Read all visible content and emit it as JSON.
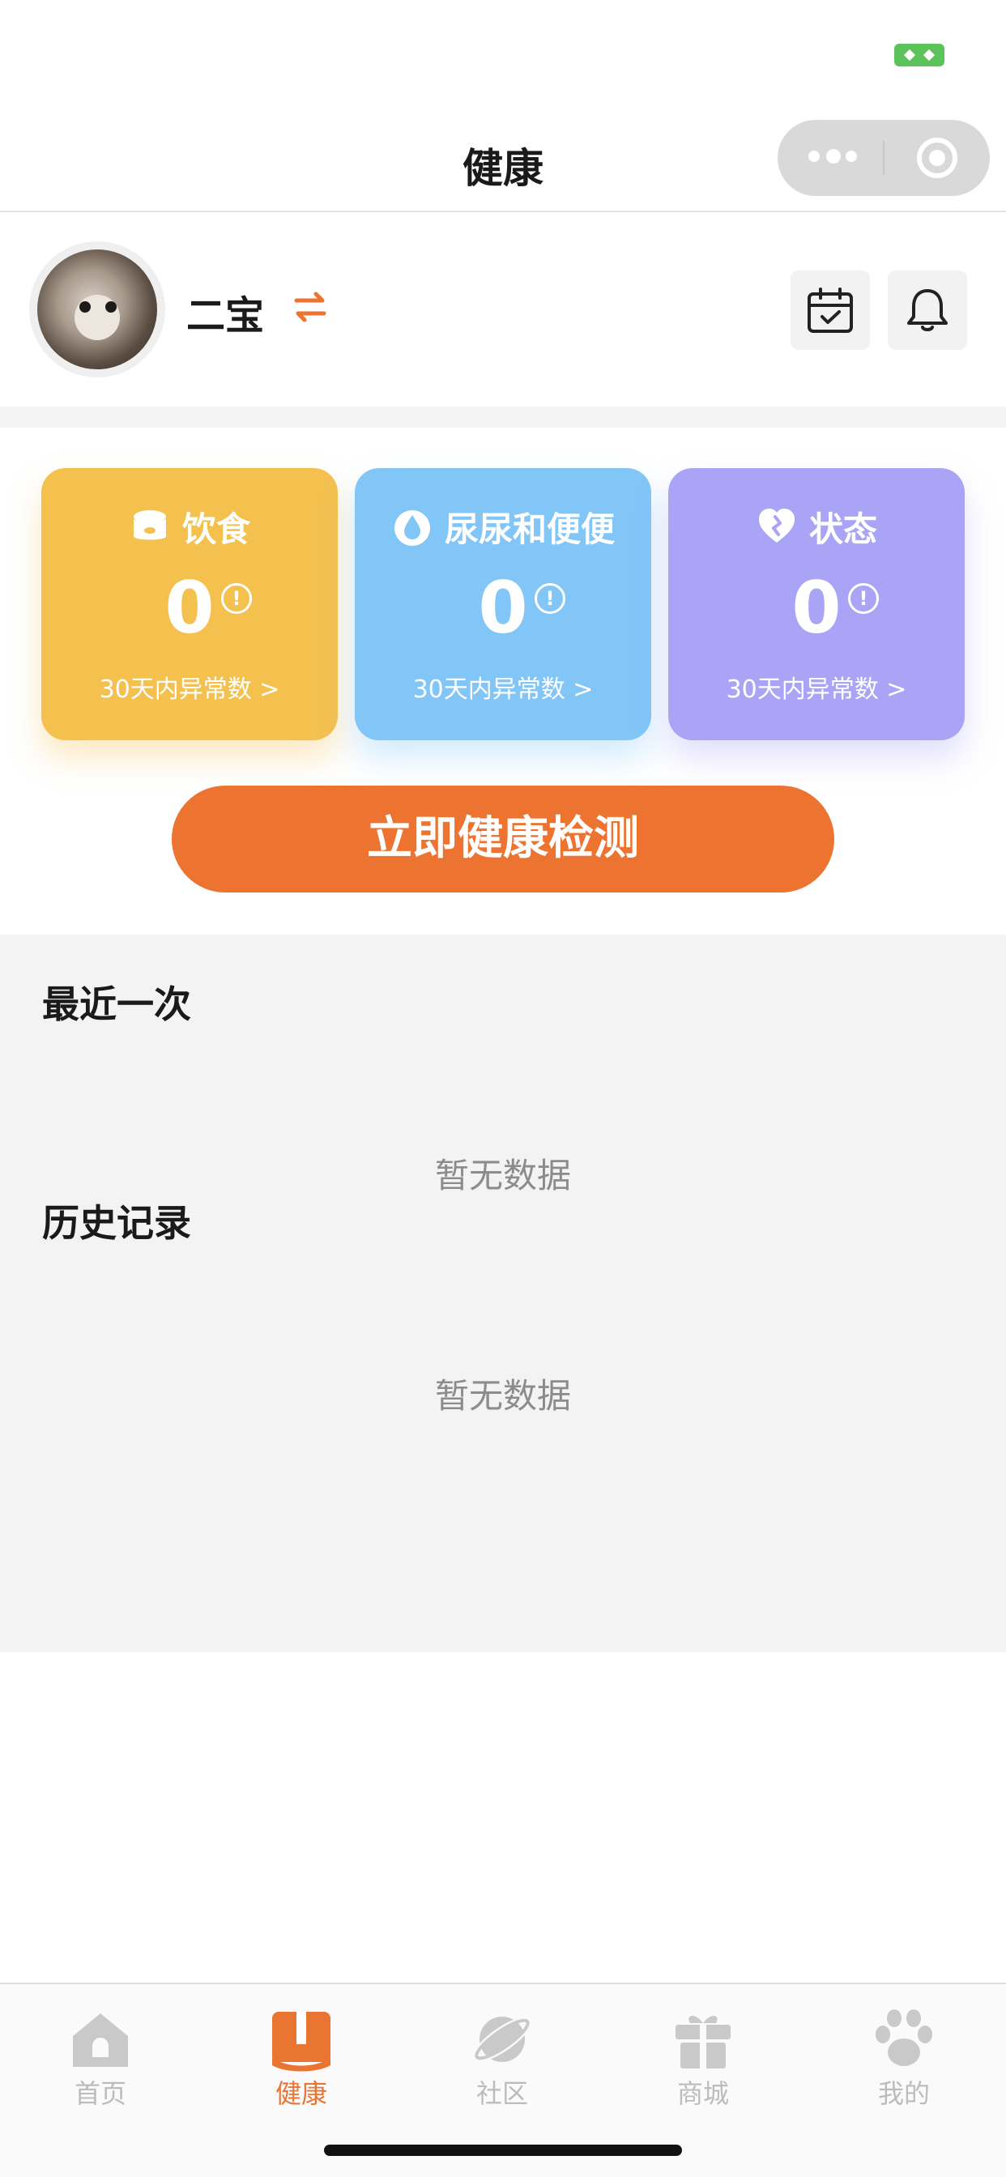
{
  "header": {
    "title": "健康"
  },
  "pet": {
    "name": "二宝"
  },
  "cards": [
    {
      "title": "饮食",
      "value": "0",
      "link": "30天内异常数 >",
      "color": "#f4c14f"
    },
    {
      "title": "尿尿和便便",
      "value": "0",
      "link": "30天内异常数 >",
      "color": "#82c6f8"
    },
    {
      "title": "状态",
      "value": "0",
      "link": "30天内异常数 >",
      "color": "#a9a4f6"
    }
  ],
  "info_mark": "!",
  "check_button": {
    "label": "立即健康检测"
  },
  "recent": {
    "title": "最近一次",
    "empty": "暂无数据"
  },
  "history": {
    "title": "历史记录",
    "empty": "暂无数据"
  },
  "tabs": [
    {
      "label": "首页",
      "icon": "home-icon"
    },
    {
      "label": "健康",
      "icon": "health-book-icon",
      "active": true
    },
    {
      "label": "社区",
      "icon": "planet-icon"
    },
    {
      "label": "商城",
      "icon": "gift-icon"
    },
    {
      "label": "我的",
      "icon": "paw-icon"
    }
  ],
  "colors": {
    "accent": "#ec7330",
    "tab_active": "#ea7532",
    "tab_inactive": "#bcbcbc"
  }
}
